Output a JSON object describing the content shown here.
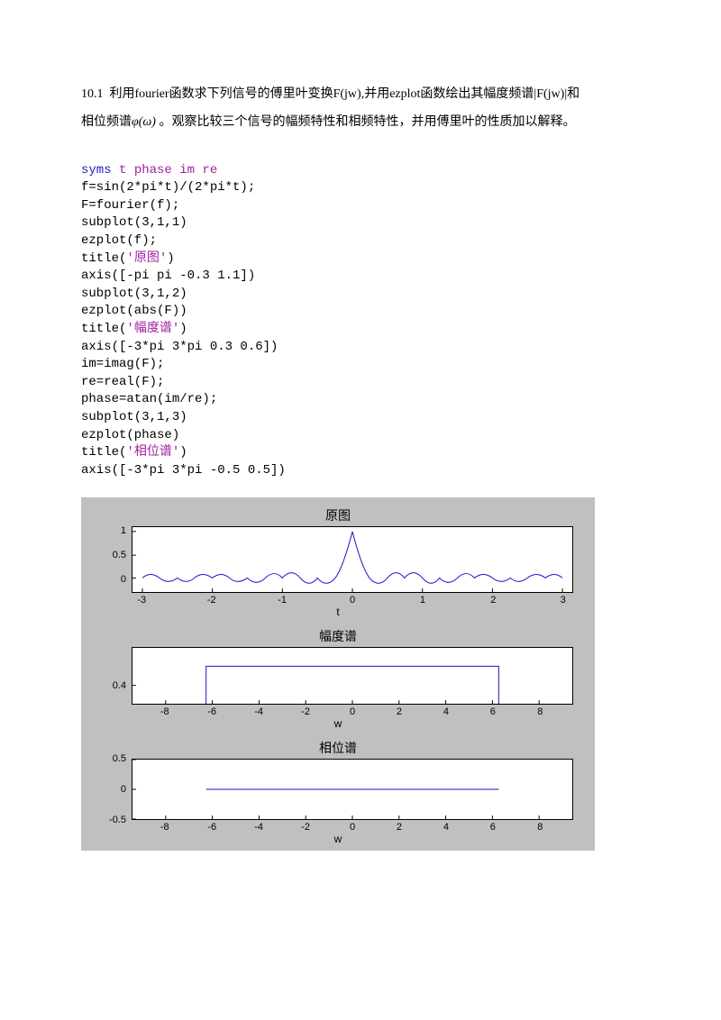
{
  "problem": {
    "num": "10.1",
    "text_a": "利用fourier函数求下列信号的傅里叶变换F(jw),并用ezplot函数绘出其幅度频谱|F(jw)|和",
    "text_b": "相位频谱",
    "phi": "φ(ω)",
    "text_c": "。观察比较三个信号的幅频特性和相频特性，并用傅里叶的性质加以解释。"
  },
  "code": {
    "l1a": "syms",
    "l1b": " t phase im re",
    "l2": "f=sin(2*pi*t)/(2*pi*t);",
    "l3": "F=fourier(f);",
    "l4": "subplot(3,1,1)",
    "l5": "ezplot(f);",
    "l6a": "title(",
    "l6b": "'原图'",
    "l6c": ")",
    "l7": "axis([-pi pi -0.3 1.1])",
    "l8": "subplot(3,1,2)",
    "l9": "ezplot(abs(F))",
    "l10a": "title(",
    "l10b": "'幅度谱'",
    "l10c": ")",
    "l11": "axis([-3*pi 3*pi 0.3 0.6])",
    "l12": "im=imag(F);",
    "l13": "re=real(F);",
    "l14": "phase=atan(im/re);",
    "l15": "subplot(3,1,3)",
    "l16": "ezplot(phase)",
    "l17a": "title(",
    "l17b": "'相位谱'",
    "l17c": ")",
    "l18": "axis([-3*pi 3*pi -0.5 0.5])"
  },
  "chart_data": [
    {
      "type": "line",
      "title": "原图",
      "xlabel": "t",
      "xlim": [
        -3.1416,
        3.1416
      ],
      "ylim": [
        -0.3,
        1.1
      ],
      "xticks": [
        -3,
        -2,
        -1,
        0,
        1,
        2,
        3
      ],
      "yticks": [
        0,
        0.5,
        1
      ],
      "series": [
        {
          "name": "sin(2*pi*t)/(2*pi*t)",
          "function": "sinc(2t)",
          "sample_x": [
            -3,
            -2.75,
            -2.5,
            -2.25,
            -2,
            -1.75,
            -1.5,
            -1.25,
            -1,
            -0.75,
            -0.5,
            -0.25,
            0,
            0.25,
            0.5,
            0.75,
            1,
            1.25,
            1.5,
            1.75,
            2,
            2.25,
            2.5,
            2.75,
            3
          ],
          "sample_y": [
            0,
            0.058,
            0,
            -0.071,
            0,
            0.091,
            0,
            -0.127,
            0,
            0.212,
            0,
            0.637,
            1,
            0.637,
            0,
            0.212,
            0,
            -0.127,
            0,
            0.091,
            0,
            -0.071,
            0,
            0.058,
            0
          ]
        }
      ]
    },
    {
      "type": "line",
      "title": "幅度谱",
      "xlabel": "w",
      "xlim": [
        -9.4248,
        9.4248
      ],
      "ylim": [
        0.3,
        0.6
      ],
      "xticks": [
        -8,
        -6,
        -4,
        -2,
        0,
        2,
        4,
        6,
        8
      ],
      "yticks": [
        0.4
      ],
      "series": [
        {
          "name": "|F(jw)|",
          "function": "0.5*rect(w/(4*pi))",
          "sample_x": [
            -6.2832,
            -6.2832,
            6.2832,
            6.2832
          ],
          "sample_y": [
            0.3,
            0.5,
            0.5,
            0.3
          ]
        }
      ]
    },
    {
      "type": "line",
      "title": "相位谱",
      "xlabel": "w",
      "xlim": [
        -9.4248,
        9.4248
      ],
      "ylim": [
        -0.5,
        0.5
      ],
      "xticks": [
        -8,
        -6,
        -4,
        -2,
        0,
        2,
        4,
        6,
        8
      ],
      "yticks": [
        -0.5,
        0,
        0.5
      ],
      "series": [
        {
          "name": "phase(F(jw))",
          "function": "0",
          "sample_x": [
            -6.2832,
            6.2832
          ],
          "sample_y": [
            0,
            0
          ]
        }
      ]
    }
  ]
}
